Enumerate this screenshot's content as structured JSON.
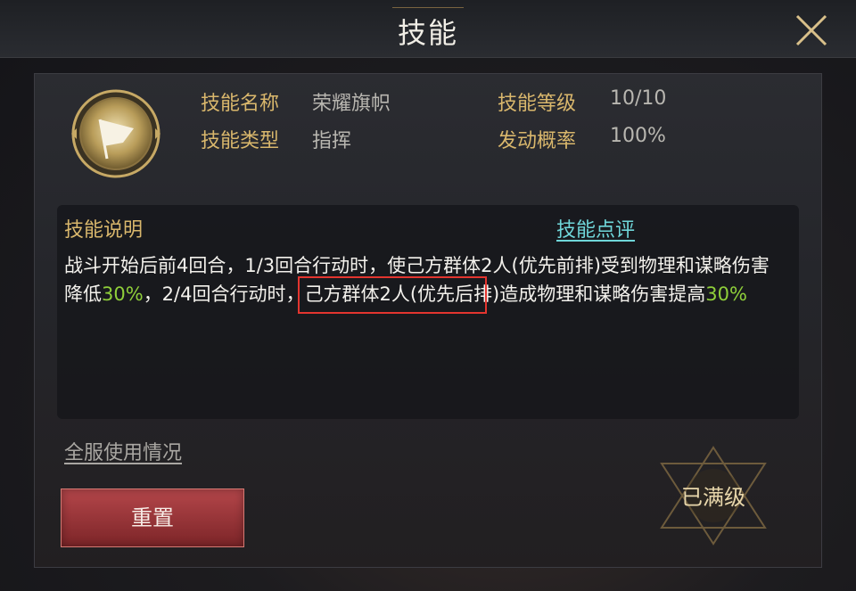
{
  "header": {
    "title": "技能",
    "close_icon": "close-icon"
  },
  "skill": {
    "icon": "flag-icon",
    "name_label": "技能名称",
    "name_value": "荣耀旗帜",
    "type_label": "技能类型",
    "type_value": "指挥",
    "level_label": "技能等级",
    "level_value": "10/10",
    "chance_label": "发动概率",
    "chance_value": "100%"
  },
  "description": {
    "title": "技能说明",
    "review_link": "技能点评",
    "text_part1": "战斗开始后前4回合，1/3回合行动时，使己方群体2人(优先前排)受到物理和谋略伤害降低",
    "value1": "30%",
    "text_part2": "，2/4回合行动时，己方群体2人(优先后排)造成物理和谋略伤害提高",
    "value2": "30%"
  },
  "footer": {
    "usage_link": "全服使用情况",
    "reset_button": "重置",
    "maxed_label": "已满级"
  },
  "colors": {
    "gold_label": "#d9b76c",
    "highlight_green": "#8fcf3a",
    "link_cyan": "#6fd6d9",
    "annotation_red": "#e3352f",
    "reset_red": "#9c3437"
  }
}
